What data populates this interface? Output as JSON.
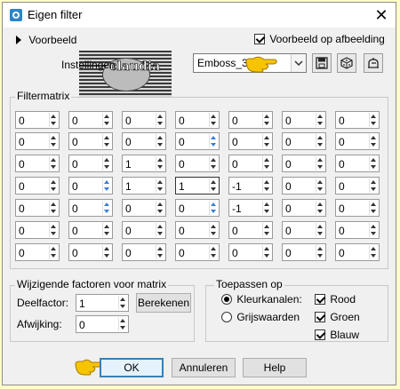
{
  "window": {
    "title": "Eigen filter",
    "close_glyph": "✕"
  },
  "preview": {
    "toggle_label": "Voorbeeld",
    "on_image_label": "Voorbeeld op afbeelding",
    "on_image_checked": true
  },
  "settings": {
    "label": "Instellingen",
    "preset_value": "Emboss_3",
    "watermark_text": "claudia"
  },
  "matrix": {
    "label": "Filtermatrix",
    "rows": [
      [
        "0",
        "0",
        "0",
        "0",
        "0",
        "0",
        "0"
      ],
      [
        "0",
        "0",
        "0",
        "0",
        "0",
        "0",
        "0"
      ],
      [
        "0",
        "0",
        "1",
        "0",
        "0",
        "0",
        "0"
      ],
      [
        "0",
        "0",
        "1",
        "1",
        "-1",
        "0",
        "0"
      ],
      [
        "0",
        "0",
        "0",
        "0",
        "-1",
        "0",
        "0"
      ],
      [
        "0",
        "0",
        "0",
        "0",
        "0",
        "0",
        "0"
      ],
      [
        "0",
        "0",
        "0",
        "0",
        "0",
        "0",
        "0"
      ]
    ]
  },
  "factors": {
    "label": "Wijzigende factoren voor matrix",
    "divisor_label": "Deelfactor:",
    "divisor_value": "1",
    "compute_label": "Berekenen",
    "offset_label": "Afwijking:",
    "offset_value": "0"
  },
  "apply_to": {
    "label": "Toepassen op",
    "color_channels_label": "Kleurkanalen:",
    "grayscale_label": "Grijswaarden",
    "selected": "Kleurkanalen",
    "red_label": "Rood",
    "green_label": "Groen",
    "blue_label": "Blauw"
  },
  "buttons": {
    "ok": "OK",
    "cancel": "Annuleren",
    "help": "Help"
  },
  "colors": {
    "page_bg": "#ffffc8",
    "dialog_bg": "#f0f0f0",
    "pointer_yellow": "#f6c400",
    "default_border": "#3c7fb1"
  }
}
